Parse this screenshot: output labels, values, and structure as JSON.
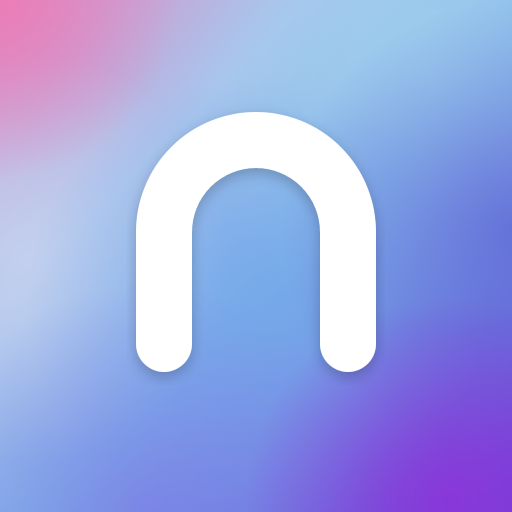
{
  "app_icon": {
    "glyph": "n-arch-icon",
    "colors": {
      "glyph": "#ffffff",
      "gradient_top_left": "#e48cc0",
      "gradient_left": "#b8c6ea",
      "gradient_top_right": "#8fc6ec",
      "gradient_center": "#7aaee8",
      "gradient_right": "#6f7fdc",
      "gradient_bottom": "#6a6fe0",
      "gradient_bottom_right": "#8a3fd8"
    }
  }
}
